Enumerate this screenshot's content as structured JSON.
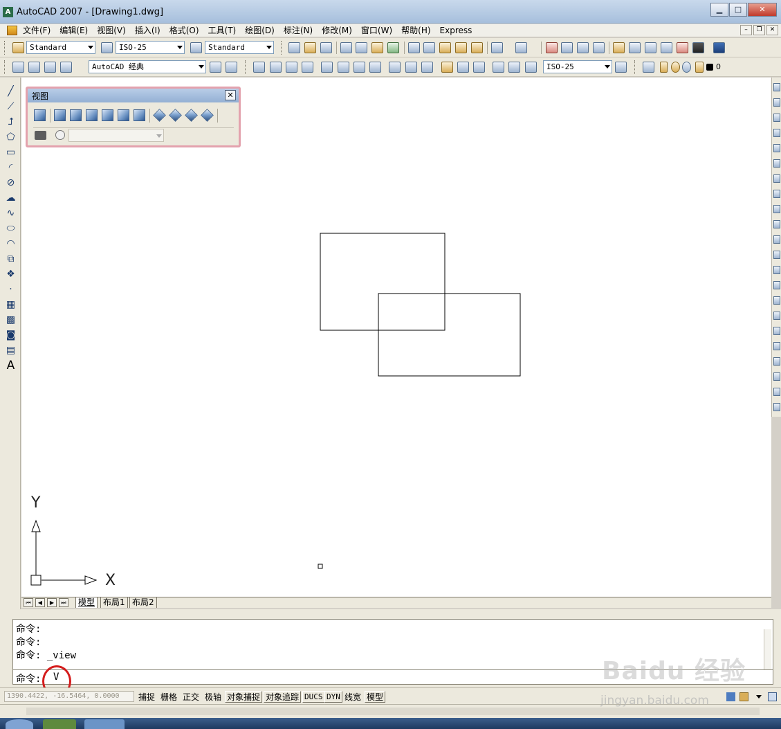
{
  "window": {
    "title": "AutoCAD 2007 - [Drawing1.dwg]",
    "app_icon_letter": "A",
    "min": "▁",
    "max": "□",
    "close": "✕"
  },
  "menu": {
    "items": [
      "文件(F)",
      "编辑(E)",
      "视图(V)",
      "插入(I)",
      "格式(O)",
      "工具(T)",
      "绘图(D)",
      "标注(N)",
      "修改(M)",
      "窗口(W)",
      "帮助(H)",
      "Express"
    ],
    "mdi_min": "–",
    "mdi_restore": "❐",
    "mdi_close": "✕"
  },
  "styles_toolbar": {
    "text_style": "Standard",
    "dim_style": "ISO-25",
    "table_style": "Standard"
  },
  "workspace_toolbar": {
    "workspace": "AutoCAD 经典",
    "dim_style": "ISO-25",
    "layer_name": "0"
  },
  "view_toolbar": {
    "title": "视图",
    "close": "✕",
    "icons": [
      "named-views-icon",
      "top-view-icon",
      "bottom-view-icon",
      "left-view-icon",
      "right-view-icon",
      "front-view-icon",
      "back-view-icon",
      "sw-iso-icon",
      "se-iso-icon",
      "ne-iso-icon",
      "nw-iso-icon"
    ],
    "camera_icon": "camera-icon"
  },
  "draw_toolbar": {
    "tools": [
      {
        "icon": "line-icon",
        "glyph": "╱"
      },
      {
        "icon": "construction-line-icon",
        "glyph": "⟋"
      },
      {
        "icon": "polyline-icon",
        "glyph": "⮥"
      },
      {
        "icon": "polygon-icon",
        "glyph": "⬠"
      },
      {
        "icon": "rectangle-icon",
        "glyph": "▭"
      },
      {
        "icon": "arc-icon",
        "glyph": "◜"
      },
      {
        "icon": "circle-icon",
        "glyph": "⊘"
      },
      {
        "icon": "revision-cloud-icon",
        "glyph": "☁"
      },
      {
        "icon": "spline-icon",
        "glyph": "∿"
      },
      {
        "icon": "ellipse-icon",
        "glyph": "⬭"
      },
      {
        "icon": "ellipse-arc-icon",
        "glyph": "◠"
      },
      {
        "icon": "insert-block-icon",
        "glyph": "⧉"
      },
      {
        "icon": "make-block-icon",
        "glyph": "❖"
      },
      {
        "icon": "point-icon",
        "glyph": "·"
      },
      {
        "icon": "hatch-icon",
        "glyph": "▦"
      },
      {
        "icon": "gradient-icon",
        "glyph": "▩"
      },
      {
        "icon": "region-icon",
        "glyph": "◙"
      },
      {
        "icon": "table-icon",
        "glyph": "▤"
      },
      {
        "icon": "multiline-text-icon",
        "glyph": "A"
      }
    ]
  },
  "ucs": {
    "x_label": "X",
    "y_label": "Y"
  },
  "layout_tabs": {
    "nav": [
      "⏮",
      "◀",
      "▶",
      "⏭"
    ],
    "tabs": [
      "模型",
      "布局1",
      "布局2"
    ],
    "active": "模型"
  },
  "command": {
    "history": [
      "命令:",
      "命令:",
      "命令: _view"
    ],
    "prompt": "命令:",
    "input_value": "V"
  },
  "status": {
    "coords": "1390.4422,  -16.5464,  0.0000",
    "toggles": [
      {
        "label": "捕捉",
        "on": false
      },
      {
        "label": "栅格",
        "on": false
      },
      {
        "label": "正交",
        "on": false
      },
      {
        "label": "极轴",
        "on": false
      },
      {
        "label": "对象捕捉",
        "on": true
      },
      {
        "label": "对象追踪",
        "on": true
      },
      {
        "label": "DUCS",
        "on": true
      },
      {
        "label": "DYN",
        "on": true
      },
      {
        "label": "线宽",
        "on": false
      },
      {
        "label": "模型",
        "on": true
      }
    ]
  },
  "watermark": {
    "brand": "Baidu 经验",
    "url": "jingyan.baidu.com"
  },
  "colors": {
    "canvas": "#ffffff",
    "highlight_circle": "#d41c1c",
    "float_border": "#e3a2ad"
  }
}
